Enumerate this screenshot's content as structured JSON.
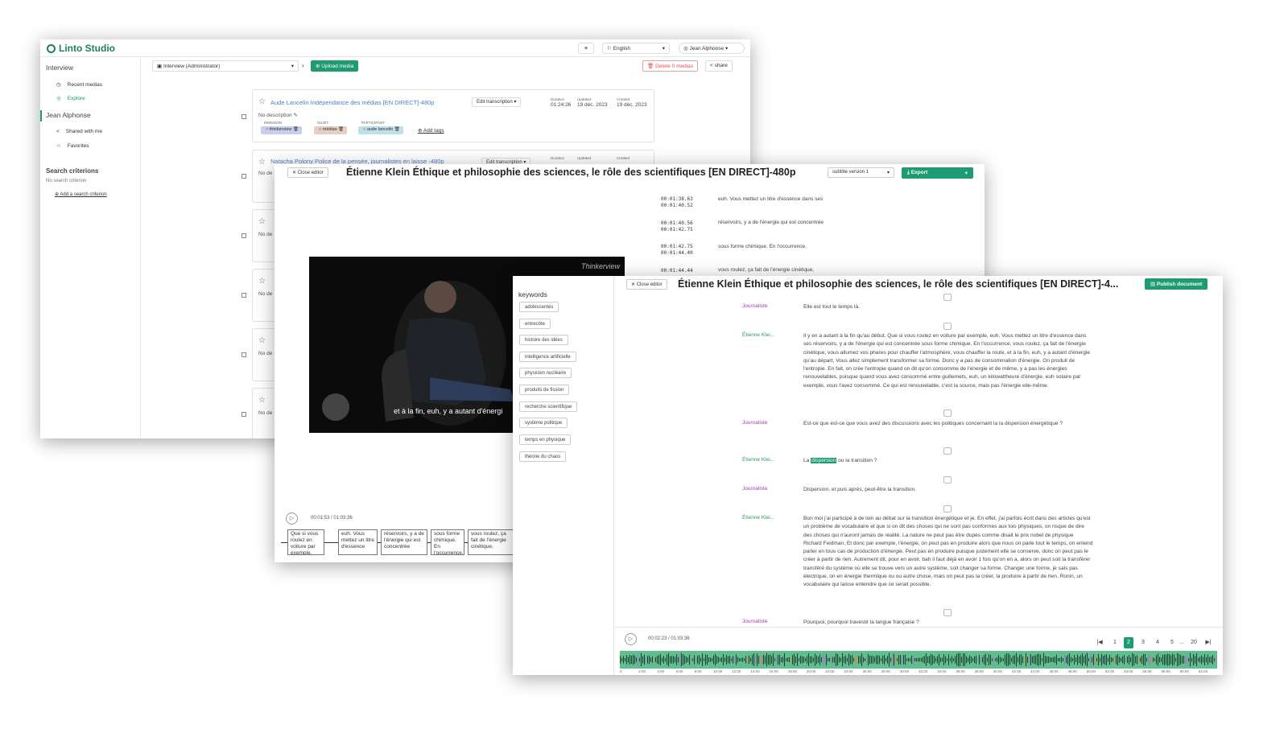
{
  "explore_window": {
    "app_name": "Linto Studio",
    "header": {
      "language": "English",
      "user": "Jean Alphonse"
    },
    "sidebar": {
      "section_interview": "Interview",
      "items": [
        "Recent medias",
        "Explore"
      ],
      "section_user": "Jean Alphonse",
      "user_items": [
        "Shared with me",
        "Favorites"
      ],
      "search_title": "Search criterions",
      "search_empty": "No search criterion",
      "add_criterion": "Add a search criterion"
    },
    "toolbar": {
      "org": "Interview (Administrator)",
      "upload": "Upload media",
      "delete": "Delete 0 medias",
      "share": "share"
    },
    "cards": [
      {
        "title": "Aude Lancelin Indépendance des médias [EN DIRECT]-480p",
        "edit": "Edit transcription",
        "duration_label": "Duration",
        "duration": "01:24:26",
        "updated_label": "Updated",
        "updated": "19 déc. 2023",
        "created_label": "Created",
        "created": "19 déc. 2023",
        "description": "No description",
        "tags": [
          {
            "label": "ÉMISSION",
            "value": "thinkerview"
          },
          {
            "label": "SUJET",
            "value": "médias"
          },
          {
            "label": "PARTICIPANT",
            "value": "aude lancelin"
          }
        ],
        "add_tags": "Add tags"
      },
      {
        "title": "Natacha Polony Police de la pensée, journalistes en laisse -480p",
        "edit": "Edit transcription",
        "duration_label": "Duration",
        "updated_label": "Updated",
        "created_label": "Created",
        "description": "No de"
      }
    ],
    "partial_rows": [
      "No de",
      "No de",
      "No de",
      "No de"
    ]
  },
  "subtitle_window": {
    "close": "Close editor",
    "title": "Étienne Klein Éthique et philosophie des sciences, le rôle des scientifiques [EN DIRECT]-480p",
    "version": "subtitle version 1",
    "export": "Export",
    "subtitles": [
      {
        "start": "00:01:38.63",
        "end": "00:01:40.52",
        "text": "euh. Vous mettez un litre d'essence dans ses"
      },
      {
        "start": "00:01:40.56",
        "end": "00:01:42.75",
        "text": "réservoirs, y a de l'énergie qui est concentrée"
      },
      {
        "start": "00:01:42.75",
        "end": "00:01:44.40",
        "text": "sous forme chimique. En l'occurrence,"
      },
      {
        "start": "00:01:44.44",
        "end": "",
        "text": "vous roulez, ça fait de l'énergie cinétique,"
      }
    ],
    "video": {
      "brand": "Thinkerview",
      "caption": "et à la fin, euh, y a autant d'énergi"
    },
    "player": {
      "time": "00:01:53 / 01:03:36"
    },
    "segments": [
      "Que si vous roulez en voiture par exemple,",
      "euh. Vous mettez un litre d'essence",
      "réservoirs, y a de l'énergie qui est concentrée",
      "sous forme chimique. En l'occurrence,",
      "vous roulez, ça fait de l'énergie cinétique,"
    ]
  },
  "transcription_window": {
    "close": "Close editor",
    "title": "Étienne Klein Éthique et philosophie des sciences, le rôle des scientifiques [EN DIRECT]-4...",
    "publish": "Publish document",
    "keywords_title": "keywords",
    "keywords": [
      "adolescentes",
      "entrecôte",
      "histoire des idées",
      "intelligence artificielle",
      "physicien nucléaire",
      "produits de fission",
      "recherche scientifique",
      "système politique",
      "temps en physique",
      "théorie du chaos"
    ],
    "turns": [
      {
        "speaker": "Journaliste",
        "type": "j",
        "text": "Elle est tout le temps là."
      },
      {
        "speaker": "Étienne Klei...",
        "type": "e",
        "text": "Il y en a autant à la fin qu'au début. Que si vous roulez en voiture par exemple, euh. Vous mettez un litre d'essence dans ses réservoirs, y a de l'énergie qui est concentrée sous forme chimique. En l'occurrence, vous roulez, ça fait de l'énergie cinétique, vous allumez vos phares pour chauffer l'atmosphère, vous chauffer la route, et à la fin, euh, y a autant d'énergie qu'au départ, Vous allez simplement transformer sa forme. Donc y a pas de consommation d'énergie. On produit de l'entropie. En fait, on crée l'entropie quand on dit qu'on consomme de l'énergie et de même, y a pas les énergies renouvelables, puisque quand vous avez consommé entre guillemets, euh, un kilowattheure d'énergie, euh solaire par exemple, vous l'avez consommé. Ce qui est renouvelable, c'est la source, mais pas l'énergie elle-même."
      },
      {
        "speaker": "Journaliste",
        "type": "j",
        "text": "Est-ce que est-ce que vous avez des discussions avec les politiques concernant la la dispersion énergétique ?"
      },
      {
        "speaker": "Étienne Klei...",
        "type": "e",
        "pre": "La ",
        "highlight": "dispersion",
        "post": " ou la transition ?"
      },
      {
        "speaker": "Journaliste",
        "type": "j",
        "text": "Dispersion, et puis après, peut-être la transition."
      },
      {
        "speaker": "Étienne Klei...",
        "type": "e",
        "text": "Bon moi j'ai participé à de loin au débat sur la transition énergétique et je. En effet, j'ai parfois écrit dans des articles qu'est un problème de vocabulaire et que si on dit des choses qui ne sont pas conformes aux lois physiques, on risque de dire des choses qui n'auront jamais de réalité. La nature ne peut pas être dupés comme disait le prix nobel de physique Richard Feidman, Et donc par exemple, l'énergie, on peut pas en produire alors que nous on parle tout le temps, on entend parler en tous cas de production d'énergie. Peut pas en produire puisque justement elle se conserve, donc on peut pas le créer à partir de rien. Autrement dit, pour en avoir, bah il faut déjà en avoir 1 fois qu'on en a, alors on peut soit la transférer transféré du système où elle se trouve vers un autre système, soit changer sa forme. Changer une forme, je sais pas électrique, on en énergie thermique ou ou autre chose, mais on peut pas la créer, la produire à partir de rien. Ronin, un vocabulaire qui laisse entendre que ce serait possible."
      },
      {
        "speaker": "Journaliste",
        "type": "j",
        "text": "Pourquoi, pourquoi travestir la langue française ?"
      }
    ],
    "player": {
      "time": "00:02:23 / 01:03:36"
    },
    "pagination": [
      "1",
      "2",
      "3",
      "4",
      "5",
      "...",
      "20"
    ],
    "current_page": "2",
    "timeline_ticks": [
      "0",
      "2:00",
      "4:00",
      "6:00",
      "8:00",
      "10:00",
      "12:00",
      "14:00",
      "16:00",
      "18:00",
      "20:00",
      "22:00",
      "24:00",
      "26:00",
      "28:00",
      "30:00",
      "32:00",
      "34:00",
      "36:00",
      "38:00",
      "40:00",
      "42:00",
      "44:00",
      "46:00",
      "48:00",
      "50:00",
      "52:00",
      "54:00",
      "56:00",
      "58:00",
      "60:00",
      "62:00"
    ]
  },
  "colors": {
    "brand_green": "#1e9b73",
    "link_blue": "#4a7fc9",
    "speaker_journaliste": "#9b3fb5",
    "speaker_etienne": "#2b9b5d",
    "delete_red": "#d9534f"
  }
}
